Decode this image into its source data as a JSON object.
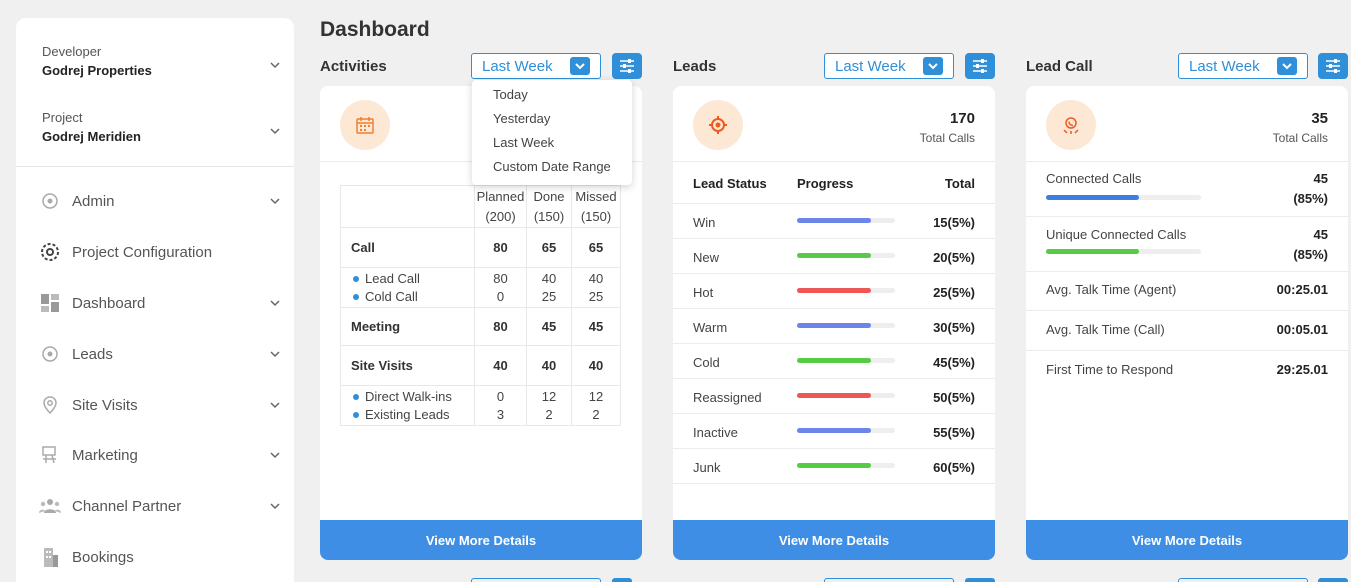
{
  "page": {
    "title": "Dashboard"
  },
  "sidebar": {
    "developer": {
      "label": "Developer",
      "value": "Godrej Properties"
    },
    "project": {
      "label": "Project",
      "value": "Godrej Meridien"
    },
    "items": [
      {
        "label": "Admin",
        "icon": "admin-icon",
        "has_chevron": true
      },
      {
        "label": "Project Configuration",
        "icon": "gear-icon",
        "has_chevron": false
      },
      {
        "label": "Dashboard",
        "icon": "dashboard-icon",
        "has_chevron": true
      },
      {
        "label": "Leads",
        "icon": "target-icon",
        "has_chevron": true
      },
      {
        "label": "Site Visits",
        "icon": "location-pin-icon",
        "has_chevron": true
      },
      {
        "label": "Marketing",
        "icon": "marketing-icon",
        "has_chevron": true
      },
      {
        "label": "Channel Partner",
        "icon": "people-icon",
        "has_chevron": true
      },
      {
        "label": "Bookings",
        "icon": "building-icon",
        "has_chevron": false
      }
    ]
  },
  "activities": {
    "title": "Activities",
    "filter": "Last Week",
    "menu": [
      "Today",
      "Yesterday",
      "Last Week",
      "Custom Date Range"
    ],
    "headers": {
      "planned": "Planned",
      "planned_count": "(200)",
      "done": "Done",
      "done_count": "(150)",
      "missed": "Missed",
      "missed_count": "(150)"
    },
    "rows": {
      "call": {
        "label": "Call",
        "planned": "80",
        "done": "65",
        "missed": "65"
      },
      "lead_call": {
        "label": "Lead Call",
        "planned": "80",
        "done": "40",
        "missed": "40"
      },
      "cold_call": {
        "label": "Cold Call",
        "planned": "0",
        "done": "25",
        "missed": "25"
      },
      "meeting": {
        "label": "Meeting",
        "planned": "80",
        "done": "45",
        "missed": "45"
      },
      "site_visits": {
        "label": "Site Visits",
        "planned": "40",
        "done": "40",
        "missed": "40"
      },
      "direct_walkins": {
        "label": "Direct Walk-ins",
        "planned": "0",
        "done": "12",
        "missed": "12"
      },
      "existing_leads": {
        "label": "Existing Leads",
        "planned": "3",
        "done": "2",
        "missed": "2"
      }
    },
    "button": "View More Details"
  },
  "leads": {
    "title": "Leads",
    "filter": "Last Week",
    "total": "170",
    "total_label": "Total Calls",
    "headers": {
      "status": "Lead Status",
      "progress": "Progress",
      "total": "Total"
    },
    "rows": [
      {
        "name": "Win",
        "total": "15(5%)",
        "progress": 0.75,
        "color": "#6b86e8"
      },
      {
        "name": "New",
        "total": "20(5%)",
        "progress": 0.75,
        "color": "#55cc44"
      },
      {
        "name": "Hot",
        "total": "25(5%)",
        "progress": 0.75,
        "color": "#ee5555"
      },
      {
        "name": "Warm",
        "total": "30(5%)",
        "progress": 0.75,
        "color": "#6b86e8"
      },
      {
        "name": "Cold",
        "total": "45(5%)",
        "progress": 0.75,
        "color": "#55cc44"
      },
      {
        "name": "Reassigned",
        "total": "50(5%)",
        "progress": 0.75,
        "color": "#ee5555"
      },
      {
        "name": "Inactive",
        "total": "55(5%)",
        "progress": 0.75,
        "color": "#6b86e8"
      },
      {
        "name": "Junk",
        "total": "60(5%)",
        "progress": 0.75,
        "color": "#55cc44"
      }
    ],
    "button": "View More Details"
  },
  "lead_call": {
    "title": "Lead Call",
    "filter": "Last Week",
    "total": "35",
    "total_label": "Total Calls",
    "connected": {
      "label": "Connected Calls",
      "value": "45",
      "pct": "(85%)",
      "progress": 0.6,
      "color": "#3d7fe0"
    },
    "unique": {
      "label": "Unique Connected Calls",
      "value": "45",
      "pct": "(85%)",
      "progress": 0.6,
      "color": "#55cc44"
    },
    "agent_talk": {
      "label": "Avg. Talk Time (Agent)",
      "value": "00:25.01"
    },
    "call_talk": {
      "label": "Avg. Talk Time (Call)",
      "value": "00:05.01"
    },
    "first_response": {
      "label": "First Time to Respond",
      "value": "29:25.01"
    },
    "button": "View More Details"
  }
}
